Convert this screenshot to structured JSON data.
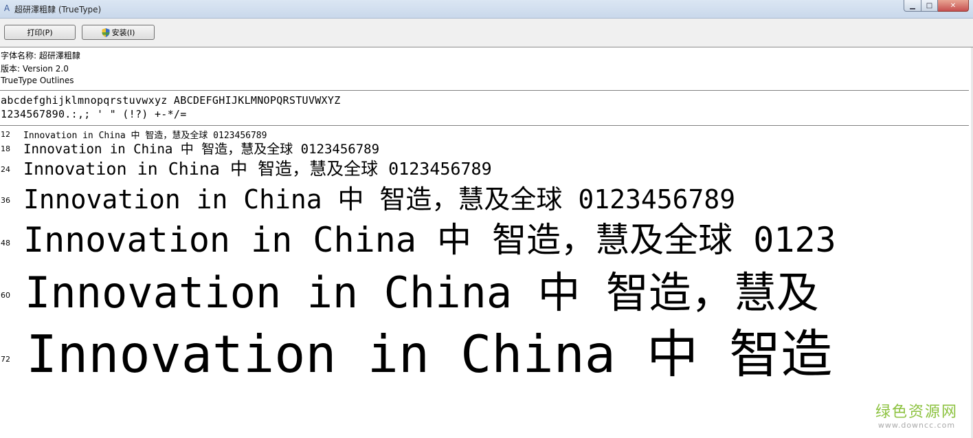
{
  "window": {
    "title": "超研澤粗隸 (TrueType)"
  },
  "toolbar": {
    "print_label": "打印(P)",
    "install_label": "安装(I)"
  },
  "info": {
    "font_name": "字体名称: 超研澤粗隸",
    "version": "版本: Version 2.0",
    "outline": "TrueType Outlines"
  },
  "charset": {
    "line1": "abcdefghijklmnopqrstuvwxyz ABCDEFGHIJKLMNOPQRSTUVWXYZ",
    "line2": "1234567890.:,; ' \" (!?) +-*/="
  },
  "samples": [
    {
      "size": "12",
      "text": "Innovation in China 中  智造，慧及全球 0123456789"
    },
    {
      "size": "18",
      "text": "Innovation in China 中  智造，慧及全球 0123456789"
    },
    {
      "size": "24",
      "text": "Innovation in China 中  智造，慧及全球 0123456789"
    },
    {
      "size": "36",
      "text": "Innovation in China 中  智造，慧及全球 0123456789"
    },
    {
      "size": "48",
      "text": "Innovation in China 中  智造，慧及全球 0123"
    },
    {
      "size": "60",
      "text": "Innovation in China 中  智造，慧及"
    },
    {
      "size": "72",
      "text": "Innovation in China 中  智造"
    }
  ],
  "watermark": {
    "cn": "绿色资源网",
    "en": "www.downcc.com"
  },
  "colors": {
    "watermark_green": "#8cc23f",
    "close_red": "#c75050"
  }
}
